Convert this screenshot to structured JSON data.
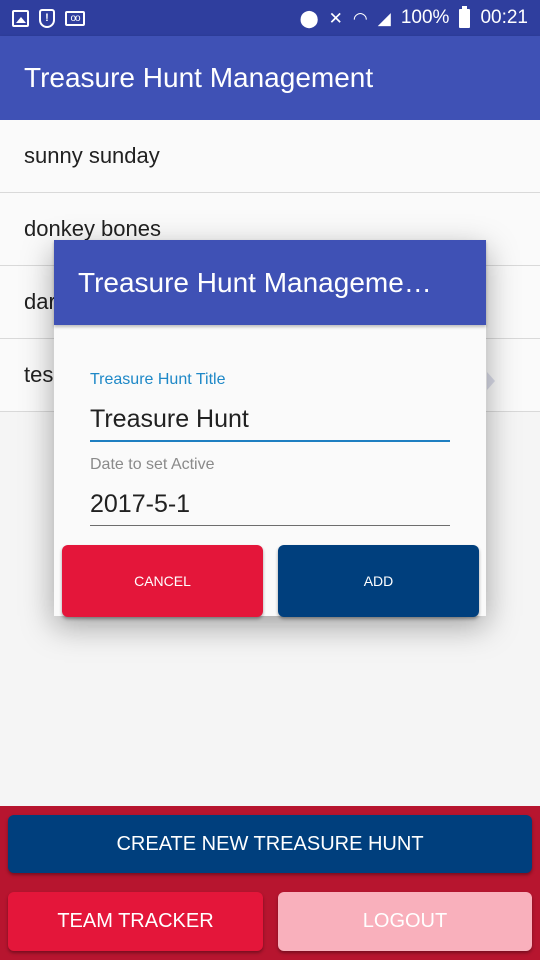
{
  "status_bar": {
    "left_icons": [
      "gallery-icon",
      "shield-alert-icon",
      "voicemail-icon"
    ],
    "right_icons": [
      "location-icon",
      "mute-icon",
      "wifi-icon",
      "signal-icon",
      "battery-icon"
    ],
    "battery": "100%",
    "time": "00:21"
  },
  "app_bar": {
    "title": "Treasure Hunt Management"
  },
  "list": {
    "items": [
      "sunny sunday",
      "donkey bones",
      "dar",
      "tes"
    ]
  },
  "dialog": {
    "title": "Treasure Hunt Manageme…",
    "title_field": {
      "label": "Treasure Hunt Title",
      "value": "Treasure Hunt"
    },
    "date_field": {
      "label": "Date to set Active",
      "value": "2017-5-1"
    },
    "cancel_label": "CANCEL",
    "add_label": "ADD"
  },
  "bottom": {
    "create_label": "CREATE NEW TREASURE HUNT",
    "team_label": "TEAM TRACKER",
    "logout_label": "LOGOUT"
  },
  "colors": {
    "primary": "#3f51b5",
    "status_bar": "#2f3e9e",
    "navy_button": "#003f7d",
    "red_button": "#e4163a",
    "pink_button": "#f9b0bc",
    "bottom_panel": "#b7152f",
    "accent_blue": "#1e88c7"
  }
}
